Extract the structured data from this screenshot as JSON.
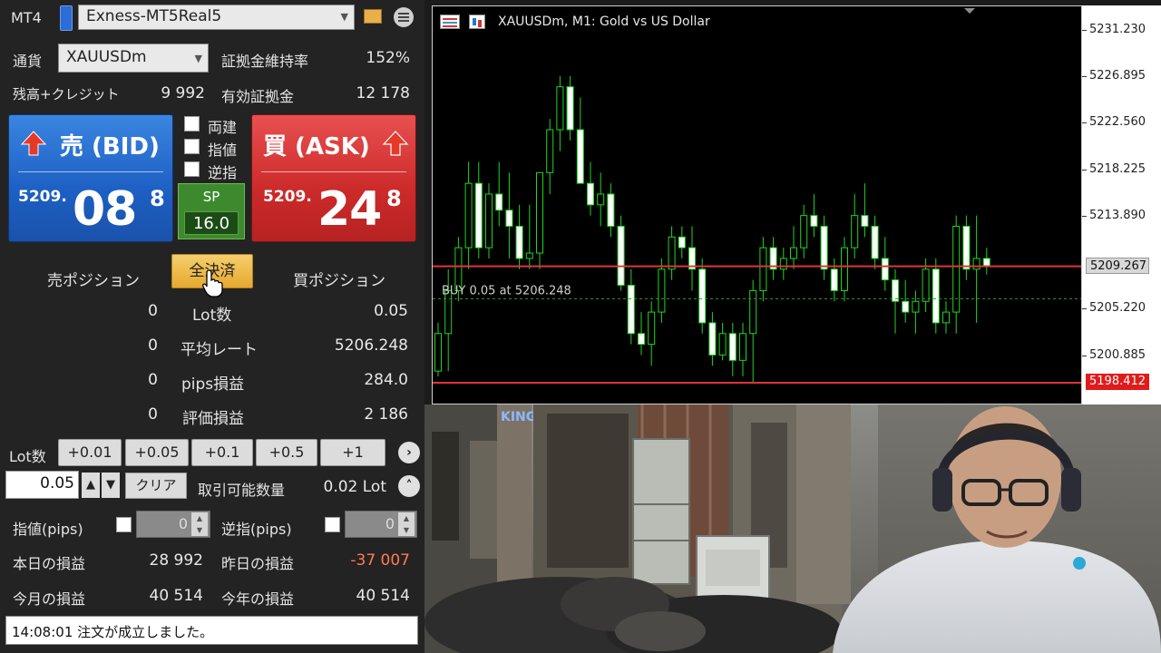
{
  "header": {
    "app": "MT4",
    "account": "Exness-MT5Real5"
  },
  "currency": {
    "label": "通貨",
    "symbol": "XAUUSDm",
    "margin_label": "証拠金維持率",
    "margin_value": "152%"
  },
  "balance": {
    "label": "残高+クレジット",
    "value": "9 992",
    "effective_label": "有効証拠金",
    "effective_value": "12 178"
  },
  "sell": {
    "title": "売 (BID)",
    "small": "5209.",
    "big": "08",
    "sup": "8"
  },
  "buy": {
    "title": "買 (ASK)",
    "small": "5209.",
    "big": "24",
    "sup": "8"
  },
  "options": {
    "hedge": "両建",
    "limit": "指値",
    "stop": "逆指"
  },
  "spread": {
    "label": "SP",
    "value": "16.0"
  },
  "positions": {
    "sell_label": "売ポジション",
    "close_all": "全決済",
    "buy_label": "買ポジション",
    "rows": [
      {
        "sell": "0",
        "label": "Lot数",
        "buy": "0.05"
      },
      {
        "sell": "0",
        "label": "平均レート",
        "buy": "5206.248"
      },
      {
        "sell": "0",
        "label": "pips損益",
        "buy": "284.0"
      },
      {
        "sell": "0",
        "label": "評価損益",
        "buy": "2 186"
      }
    ]
  },
  "lot": {
    "label": "Lot数",
    "steps": [
      "+0.01",
      "+0.05",
      "+0.1",
      "+0.5",
      "+1"
    ],
    "value": "0.05",
    "clear": "クリア",
    "tradable_label": "取引可能数量",
    "tradable_value": "0.02 Lot"
  },
  "pips": {
    "limit_label": "指値(pips)",
    "limit_value": "0",
    "stop_label": "逆指(pips)",
    "stop_value": "0"
  },
  "pnl": {
    "today_label": "本日の損益",
    "today_value": "28 992",
    "yesterday_label": "昨日の損益",
    "yesterday_value": "-37 007",
    "month_label": "今月の損益",
    "month_value": "40 514",
    "year_label": "今年の損益",
    "year_value": "40 514"
  },
  "status": {
    "message": "14:08:01 注文が成立しました。"
  },
  "chart": {
    "title": "XAUUSDm, M1:  Gold vs US Dollar",
    "position_label": "BUY 0.05 at 5206.248",
    "bid_tag": "5209.267",
    "red_tag": "5198.412",
    "ticks": [
      "5231.230",
      "5226.895",
      "5222.560",
      "5218.225",
      "5213.890",
      "5209.267",
      "5205.220",
      "5200.885"
    ]
  },
  "chart_data": {
    "type": "candlestick",
    "title": "XAUUSDm, M1:  Gold vs US Dollar",
    "ylim": [
      5196.3,
      5233.5
    ],
    "levels": {
      "bid": 5209.267,
      "buy_entry": 5206.248,
      "red_line": 5198.412
    },
    "candles": [
      [
        5199.5,
        5204.0,
        5199.0,
        5203.0
      ],
      [
        5203.0,
        5209.0,
        5199.5,
        5207.0
      ],
      [
        5207.0,
        5212.0,
        5206.0,
        5211.0
      ],
      [
        5211.0,
        5219.0,
        5209.0,
        5217.0
      ],
      [
        5217.0,
        5219.0,
        5210.0,
        5211.0
      ],
      [
        5211.0,
        5217.0,
        5210.0,
        5216.0
      ],
      [
        5216.0,
        5219.0,
        5213.0,
        5214.5
      ],
      [
        5214.5,
        5218.0,
        5210.0,
        5213.0
      ],
      [
        5213.0,
        5215.0,
        5209.0,
        5210.0
      ],
      [
        5210.0,
        5215.0,
        5209.0,
        5210.5
      ],
      [
        5210.5,
        5218.0,
        5209.0,
        5218.0
      ],
      [
        5218.0,
        5223.0,
        5216.0,
        5222.0
      ],
      [
        5222.0,
        5227.0,
        5220.0,
        5226.0
      ],
      [
        5226.0,
        5227.0,
        5221.0,
        5222.0
      ],
      [
        5222.0,
        5225.0,
        5219.0,
        5217.0
      ],
      [
        5217.0,
        5219.0,
        5214.0,
        5215.0
      ],
      [
        5215.0,
        5218.0,
        5213.0,
        5216.0
      ],
      [
        5216.0,
        5217.0,
        5212.0,
        5213.0
      ],
      [
        5213.0,
        5214.0,
        5207.0,
        5207.5
      ],
      [
        5207.5,
        5209.0,
        5202.0,
        5203.0
      ],
      [
        5203.0,
        5205.0,
        5201.0,
        5202.0
      ],
      [
        5202.0,
        5206.0,
        5200.0,
        5205.0
      ],
      [
        5205.0,
        5210.0,
        5204.0,
        5209.0
      ],
      [
        5209.0,
        5213.0,
        5208.0,
        5212.0
      ],
      [
        5212.0,
        5213.0,
        5210.0,
        5211.0
      ],
      [
        5211.0,
        5213.0,
        5207.0,
        5209.0
      ],
      [
        5209.0,
        5210.0,
        5203.0,
        5204.0
      ],
      [
        5204.0,
        5205.0,
        5200.0,
        5201.0
      ],
      [
        5201.0,
        5204.0,
        5200.5,
        5203.0
      ],
      [
        5203.0,
        5204.0,
        5199.0,
        5200.5
      ],
      [
        5200.5,
        5204.0,
        5199.0,
        5203.0
      ],
      [
        5203.0,
        5208.0,
        5198.5,
        5207.0
      ],
      [
        5207.0,
        5212.0,
        5206.0,
        5211.0
      ],
      [
        5211.0,
        5212.0,
        5208.0,
        5209.0
      ],
      [
        5209.0,
        5211.0,
        5208.0,
        5210.0
      ],
      [
        5210.0,
        5213.0,
        5209.0,
        5211.0
      ],
      [
        5211.0,
        5215.0,
        5210.0,
        5214.0
      ],
      [
        5214.0,
        5216.0,
        5212.0,
        5213.0
      ],
      [
        5213.0,
        5214.0,
        5208.0,
        5209.0
      ],
      [
        5209.0,
        5210.0,
        5206.0,
        5207.0
      ],
      [
        5207.0,
        5212.0,
        5206.0,
        5211.0
      ],
      [
        5211.0,
        5216.0,
        5210.0,
        5214.0
      ],
      [
        5214.0,
        5217.0,
        5212.0,
        5213.0
      ],
      [
        5213.0,
        5214.0,
        5209.0,
        5210.0
      ],
      [
        5210.0,
        5212.0,
        5207.0,
        5208.0
      ],
      [
        5208.0,
        5209.0,
        5203.0,
        5206.0
      ],
      [
        5206.0,
        5208.0,
        5204.0,
        5205.0
      ],
      [
        5205.0,
        5207.0,
        5203.0,
        5206.0
      ],
      [
        5206.0,
        5210.0,
        5205.0,
        5209.0
      ],
      [
        5209.0,
        5210.0,
        5203.0,
        5204.0
      ],
      [
        5204.0,
        5206.0,
        5203.0,
        5205.0
      ],
      [
        5205.0,
        5214.0,
        5203.0,
        5213.0
      ],
      [
        5213.0,
        5214.0,
        5208.0,
        5209.0
      ],
      [
        5209.0,
        5214.0,
        5204.0,
        5210.0
      ],
      [
        5210.0,
        5211.0,
        5208.5,
        5209.3
      ]
    ]
  },
  "photo": {
    "sign": "KING"
  }
}
